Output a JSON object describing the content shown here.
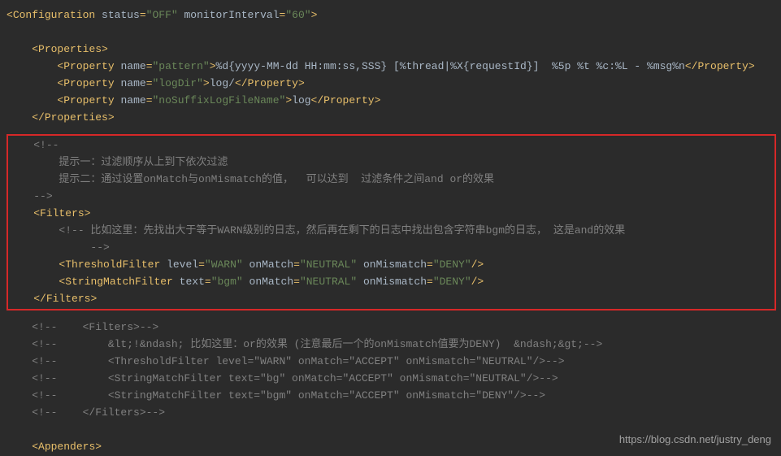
{
  "l1": {
    "tag": "Configuration",
    "a1": "status",
    "v1": "\"OFF\"",
    "a2": "monitorInterval",
    "v2": "\"60\""
  },
  "l2": {
    "tag": "Properties"
  },
  "l3": {
    "tag": "Property",
    "a": "name",
    "v": "\"pattern\"",
    "txt": "%d{yyyy-MM-dd HH:mm:ss,SSS} [%thread|%X{requestId}]  %5p %t %c:%L - %msg%n",
    "close": "Property"
  },
  "l4": {
    "tag": "Property",
    "a": "name",
    "v": "\"logDir\"",
    "txt": "log/",
    "close": "Property"
  },
  "l5": {
    "tag": "Property",
    "a": "name",
    "v": "\"noSuffixLogFileName\"",
    "txt": "log",
    "close": "Property"
  },
  "l6": {
    "close": "Properties"
  },
  "b1": "<!--",
  "b2": "        提示一：过滤顺序从上到下依次过滤",
  "b3": "        提示二：通过设置onMatch与onMismatch的值，  可以达到  过滤条件之间and or的效果",
  "b4": "-->",
  "b5": {
    "tag": "Filters"
  },
  "b6": "        <!-- 比如这里：先找出大于等于WARN级别的日志，然后再在剩下的日志中找出包含字符串bgm的日志， 这是and的效果",
  "b7": "             -->",
  "b8": {
    "tag": "ThresholdFilter",
    "a1": "level",
    "v1": "\"WARN\"",
    "a2": "onMatch",
    "v2": "\"NEUTRAL\"",
    "a3": "onMismatch",
    "v3": "\"DENY\""
  },
  "b9": {
    "tag": "StringMatchFilter",
    "a1": "text",
    "v1": "\"bgm\"",
    "a2": "onMatch",
    "v2": "\"NEUTRAL\"",
    "a3": "onMismatch",
    "v3": "\"DENY\""
  },
  "b10": {
    "close": "Filters"
  },
  "c1": "    <!--    <Filters>-->",
  "c2": "    <!--        &lt;!&ndash; 比如这里：or的效果 (注意最后一个的onMismatch值要为DENY)  &ndash;&gt;-->",
  "c3": "    <!--        <ThresholdFilter level=\"WARN\" onMatch=\"ACCEPT\" onMismatch=\"NEUTRAL\"/>-->",
  "c4": "    <!--        <StringMatchFilter text=\"bg\" onMatch=\"ACCEPT\" onMismatch=\"NEUTRAL\"/>-->",
  "c5": "    <!--        <StringMatchFilter text=\"bgm\" onMatch=\"ACCEPT\" onMismatch=\"DENY\"/>-->",
  "c6": "    <!--    </Filters>-->",
  "appenders": {
    "tag": "Appenders"
  },
  "watermark": "https://blog.csdn.net/justry_deng"
}
